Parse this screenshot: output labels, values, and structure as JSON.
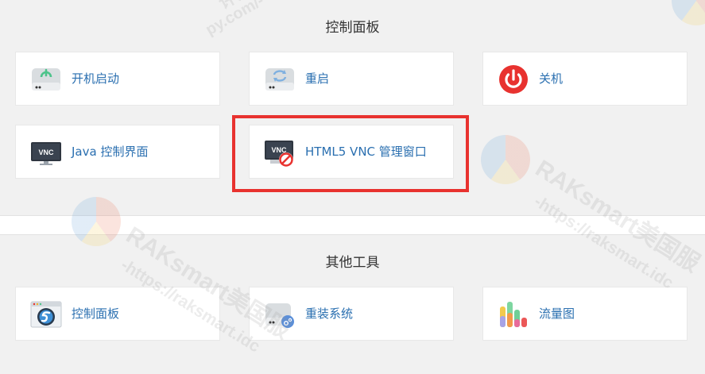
{
  "sections": {
    "control_panel": {
      "title": "控制面板",
      "cards": [
        {
          "label": "开机启动",
          "icon": "power-on-drive-icon"
        },
        {
          "label": "重启",
          "icon": "restart-drive-icon"
        },
        {
          "label": "关机",
          "icon": "shutdown-icon"
        },
        {
          "label": "Java 控制界面",
          "icon": "vnc-monitor-icon"
        },
        {
          "label": "HTML5 VNC 管理窗口",
          "icon": "vnc-disabled-monitor-icon"
        }
      ]
    },
    "other_tools": {
      "title": "其他工具",
      "cards": [
        {
          "label": "控制面板",
          "icon": "control-panel-window-icon"
        },
        {
          "label": "重装系统",
          "icon": "reinstall-drive-icon"
        },
        {
          "label": "流量图",
          "icon": "traffic-bars-icon"
        }
      ]
    }
  },
  "watermark": {
    "text_brand": "RAKsmart美国服",
    "text_url": "-https://raksmart.idc",
    "text_top": "评测",
    "text_top2": "py.com/-"
  },
  "colors": {
    "link": "#2a6fb0",
    "highlight": "#e8322f",
    "power_red": "#e8322f",
    "power_green": "#4cc38a"
  }
}
